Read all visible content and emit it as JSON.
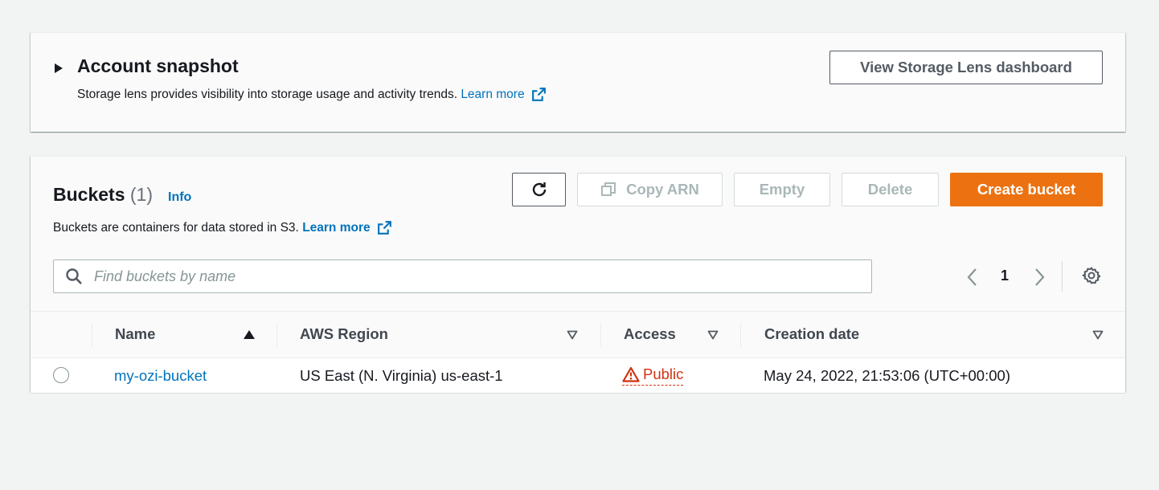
{
  "snapshot": {
    "title": "Account snapshot",
    "description": "Storage lens provides visibility into storage usage and activity trends.",
    "learn_more": "Learn more",
    "dashboard_button": "View Storage Lens dashboard"
  },
  "buckets": {
    "title": "Buckets",
    "count": "(1)",
    "info": "Info",
    "description": "Buckets are containers for data stored in S3.",
    "learn_more": "Learn more",
    "actions": {
      "copy_arn": "Copy ARN",
      "empty": "Empty",
      "delete": "Delete",
      "create": "Create bucket"
    },
    "search": {
      "placeholder": "Find buckets by name",
      "value": ""
    },
    "pagination": {
      "current_page": "1"
    },
    "columns": [
      "Name",
      "AWS Region",
      "Access",
      "Creation date"
    ],
    "rows": [
      {
        "name": "my-ozi-bucket",
        "region": "US East (N. Virginia) us-east-1",
        "access": "Public",
        "created": "May 24, 2022, 21:53:06 (UTC+00:00)"
      }
    ]
  },
  "colors": {
    "primary": "#ec7211",
    "link": "#0073bb",
    "warning": "#d13212"
  }
}
